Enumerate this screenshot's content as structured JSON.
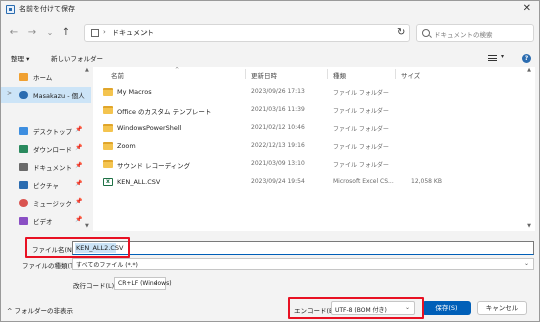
{
  "window": {
    "title": "名前を付けて保存",
    "close_glyph": "✕"
  },
  "nav": {
    "back": "←",
    "forward": "→",
    "dropdown": "⌄",
    "up": "↑",
    "address_sep": "›",
    "address_folder": "ドキュメント",
    "address_sep2": "›",
    "address_drop": "⌄",
    "refresh": "↻",
    "search_placeholder": "ドキュメントの検索"
  },
  "toolbar": {
    "organize": "整理 ▾",
    "new_folder": "新しいフォルダー",
    "view_drop": "▾",
    "help": "?"
  },
  "navpane": {
    "items": [
      {
        "label": "ホーム",
        "chevron": "",
        "icon": "home-icon",
        "color": "#f0a030",
        "pin": ""
      },
      {
        "label": "Masakazu - 個人",
        "chevron": ">",
        "icon": "cloud-icon",
        "color": "#2b6cb0",
        "pin": ""
      },
      {
        "label": "デスクトップ",
        "chevron": "",
        "icon": "desktop-icon",
        "color": "#3d8ee0",
        "pin": "📌"
      },
      {
        "label": "ダウンロード",
        "chevron": "",
        "icon": "download-icon",
        "color": "#2a8a5e",
        "pin": "📌"
      },
      {
        "label": "ドキュメント",
        "chevron": "",
        "icon": "document-icon",
        "color": "#6a6a6a",
        "pin": "📌"
      },
      {
        "label": "ピクチャ",
        "chevron": "",
        "icon": "picture-icon",
        "color": "#2b6cb0",
        "pin": "📌"
      },
      {
        "label": "ミュージック",
        "chevron": "",
        "icon": "music-icon",
        "color": "#d9534f",
        "pin": "📌"
      },
      {
        "label": "ビデオ",
        "chevron": "",
        "icon": "video-icon",
        "color": "#8a4fc4",
        "pin": "📌"
      }
    ]
  },
  "filelist": {
    "columns": {
      "name": "名前",
      "date": "更新日時",
      "type": "種類",
      "size": "サイズ"
    },
    "sort_caret": "^",
    "rows": [
      {
        "name": "My Macros",
        "date": "2023/09/26 17:13",
        "type": "ファイル フォルダー",
        "size": "",
        "icon": "folder-icon"
      },
      {
        "name": "Office のカスタム テンプレート",
        "date": "2021/03/16 11:39",
        "type": "ファイル フォルダー",
        "size": "",
        "icon": "folder-icon"
      },
      {
        "name": "WindowsPowerShell",
        "date": "2021/02/12 10:46",
        "type": "ファイル フォルダー",
        "size": "",
        "icon": "folder-icon"
      },
      {
        "name": "Zoom",
        "date": "2022/12/13 19:16",
        "type": "ファイル フォルダー",
        "size": "",
        "icon": "folder-icon"
      },
      {
        "name": "サウンド レコーディング",
        "date": "2021/03/09 13:10",
        "type": "ファイル フォルダー",
        "size": "",
        "icon": "folder-icon"
      },
      {
        "name": "KEN_ALL.CSV",
        "date": "2023/09/24 19:54",
        "type": "Microsoft Excel CS...",
        "size": "12,058 KB",
        "icon": "excel-icon"
      }
    ]
  },
  "form": {
    "filename_label": "ファイル名(N):",
    "filename_value": "KEN_ALL2.CSV",
    "filetype_label": "ファイルの種類(T):",
    "filetype_value": "すべてのファイル (*.*)",
    "filetype_drop": "⌄",
    "eol_label": "改行コード(L):",
    "eol_value": "CR+LF (Windows)",
    "eol_drop": "⌄"
  },
  "footer": {
    "hide_folders": "^ フォルダーの非表示",
    "encoding_label": "エンコード(E):",
    "encoding_value": "UTF-8 (BOM 付き)",
    "encoding_drop": "⌄",
    "save": "保存(S)",
    "cancel": "キャンセル"
  },
  "colors": {
    "accent": "#005fb8",
    "highlight": "#e81123",
    "selection": "#cce4f7",
    "folder": "#f4c44f"
  }
}
